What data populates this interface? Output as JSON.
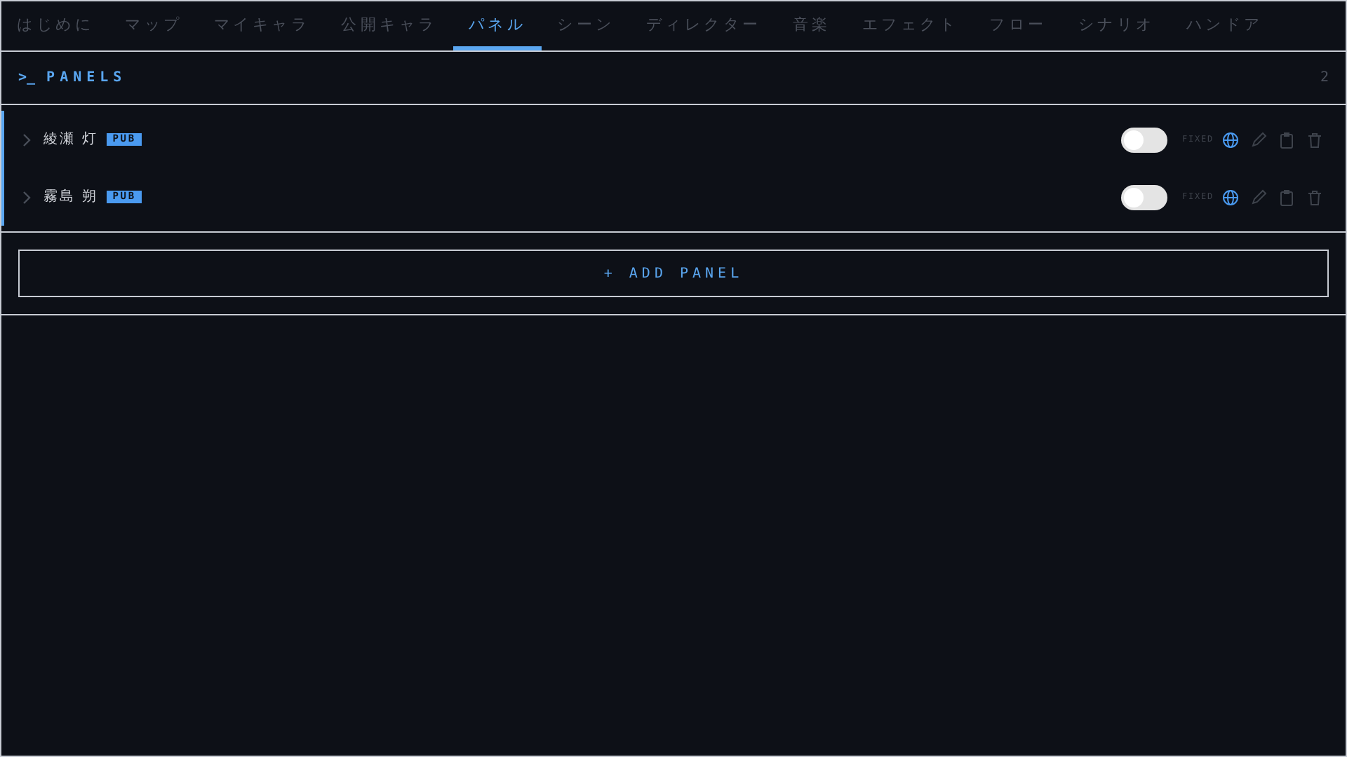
{
  "tabs": [
    {
      "label": "はじめに",
      "selected": false
    },
    {
      "label": "マップ",
      "selected": false
    },
    {
      "label": "マイキャラ",
      "selected": false
    },
    {
      "label": "公開キャラ",
      "selected": false
    },
    {
      "label": "パネル",
      "selected": true
    },
    {
      "label": "シーン",
      "selected": false
    },
    {
      "label": "ディレクター",
      "selected": false
    },
    {
      "label": "音楽",
      "selected": false
    },
    {
      "label": "エフェクト",
      "selected": false
    },
    {
      "label": "フロー",
      "selected": false
    },
    {
      "label": "シナリオ",
      "selected": false
    },
    {
      "label": "ハンドア",
      "selected": false
    }
  ],
  "section": {
    "prompt": ">_",
    "title": "PANELS",
    "count": "2"
  },
  "panels": [
    {
      "name": "綾瀬 灯",
      "badge": "PUB",
      "on": false,
      "tag": "FIXED"
    },
    {
      "name": "霧島 朔",
      "badge": "PUB",
      "on": false,
      "tag": "FIXED"
    }
  ],
  "add_button": "+ ADD PANEL"
}
